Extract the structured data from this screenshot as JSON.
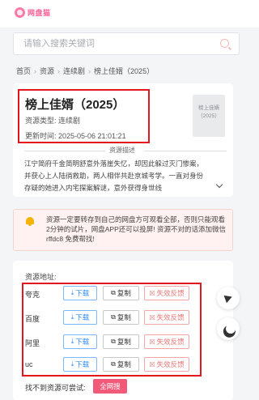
{
  "app": {
    "logo_text": "网盘猫"
  },
  "search": {
    "placeholder": "请输入搜索关键词"
  },
  "breadcrumb": [
    "首页",
    "资源",
    "连续剧",
    "榜上佳婿（2025）"
  ],
  "detail": {
    "title": "榜上佳婿（2025）",
    "type_label": "资源类型: 连续剧",
    "updated": "更新时间: 2025-05-06 21:01:21",
    "poster_text_1": "榜上佳婿",
    "poster_text_2": "（2025）",
    "desc_heading": "资源描述",
    "description": "江宁简府千金简明舒意外落崖失忆，却因此躲过灭门惨案，并获心上人陆徜救助，两人相伴共赴京城考学。一直对身份存疑的她进入内宅探案解谜，意外获得身世线"
  },
  "notice": {
    "text": "资源一定要转存到自己的网盘方可观看全部，否则只能观看2分钟的试片，网盘APP还可以投屏! 资源不对的话添加微信 rffdc8 免费帮找!"
  },
  "resources": {
    "heading": "资源地址:",
    "download_label": "下载",
    "copy_label": "复制",
    "report_label": "失效反馈",
    "items": [
      {
        "name": "夸克"
      },
      {
        "name": "百度"
      },
      {
        "name": "阿里"
      },
      {
        "name": "uc"
      }
    ],
    "fallback_text": "找不到资源可尝试:",
    "all_search_label": "全网搜"
  }
}
